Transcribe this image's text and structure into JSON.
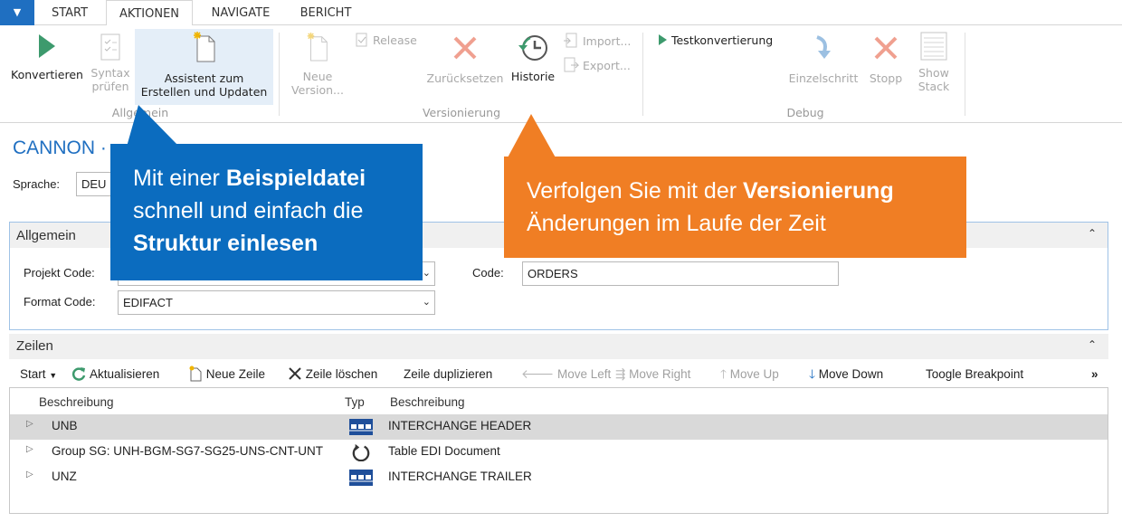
{
  "tabs": {
    "app_menu": "▼",
    "items": [
      "START",
      "AKTIONEN",
      "NAVIGATE",
      "BERICHT"
    ],
    "active": "AKTIONEN"
  },
  "ribbon": {
    "allgemein": {
      "label": "Allgemein",
      "konvertieren": "Konvertieren",
      "syntax_1": "Syntax",
      "syntax_2": "prüfen",
      "assistent_1": "Assistent zum",
      "assistent_2": "Erstellen und Updaten"
    },
    "versionierung": {
      "label": "Versionierung",
      "neue_1": "Neue",
      "neue_2": "Version...",
      "release": "Release",
      "zuruecksetzen": "Zurücksetzen",
      "historie": "Historie",
      "import": "Import...",
      "export": "Export..."
    },
    "debug": {
      "label": "Debug",
      "testkonvertierung": "Testkonvertierung",
      "einzelschritt": "Einzelschritt",
      "stopp": "Stopp",
      "show_1": "Show",
      "show_2": "Stack"
    }
  },
  "page_title": "CANNON · ",
  "form": {
    "sprache_label": "Sprache:",
    "sprache_value": "DEU",
    "allgemein_section": "Allgemein",
    "projekt_code_label": "Projekt Code:",
    "projekt_code_value": "",
    "format_code_label": "Format Code:",
    "format_code_value": "EDIFACT",
    "code_label": "Code:",
    "code_value": "ORDERS"
  },
  "zeilen": {
    "section": "Zeilen",
    "toolbar": {
      "start": "Start",
      "aktualisieren": "Aktualisieren",
      "neue_zeile": "Neue Zeile",
      "zeile_loeschen": "Zeile löschen",
      "zeile_duplizieren": "Zeile duplizieren",
      "move_left": "Move Left",
      "move_right": "Move Right",
      "move_up": "Move Up",
      "move_down": "Move Down",
      "toogle_breakpoint": "Toogle Breakpoint",
      "more": "»"
    },
    "headers": [
      "Beschreibung",
      "Typ",
      "Beschreibung"
    ],
    "rows": [
      {
        "name": "UNB",
        "typ_icon": "segment-grid-icon",
        "desc": "INTERCHANGE HEADER"
      },
      {
        "name": "Group SG: UNH-BGM-SG7-SG25-UNS-CNT-UNT",
        "typ_icon": "loop-icon",
        "desc": "Table EDI Document"
      },
      {
        "name": "UNZ",
        "typ_icon": "segment-grid-icon",
        "desc": "INTERCHANGE TRAILER"
      }
    ]
  },
  "callouts": {
    "blue": {
      "p1": "Mit einer ",
      "b1": "Beispieldatei",
      "p2": "schnell und einfach die",
      "b2": "Struktur einlesen"
    },
    "orange": {
      "p1": "Verfolgen Sie mit der ",
      "b1": "Versionierung",
      "p2": "Änderungen im Laufe der Zeit"
    }
  },
  "colors": {
    "accent": "#1f6fc1",
    "callout_blue": "#0b6cbf",
    "callout_orange": "#f07e24"
  }
}
